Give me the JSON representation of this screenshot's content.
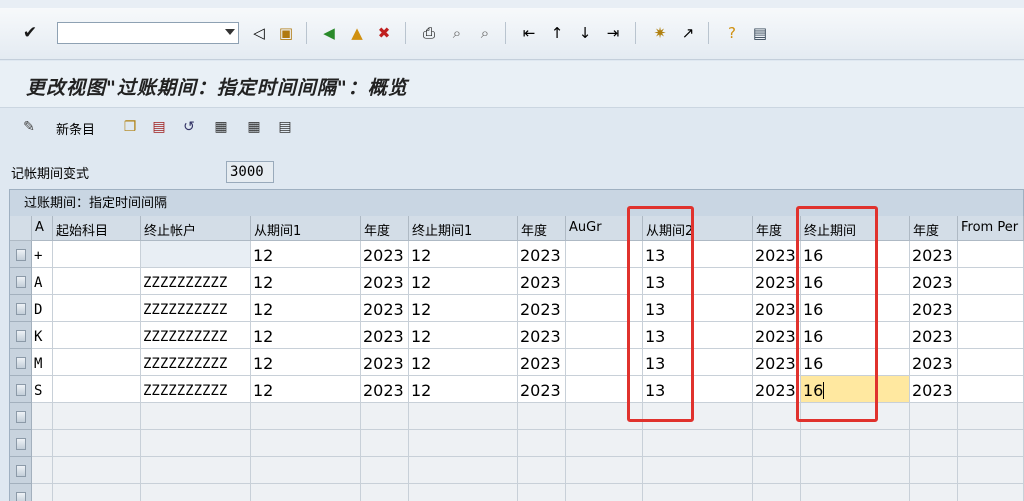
{
  "toolbar": {
    "command_value": "",
    "icons": [
      "enter-icon",
      "back-icon",
      "save-icon",
      "back-nav-icon",
      "exit-icon",
      "cancel-icon",
      "print-icon",
      "find-icon",
      "find-next-icon",
      "first-page-icon",
      "prev-page-icon",
      "next-page-icon",
      "last-page-icon",
      "new-session-icon",
      "shortcut-icon",
      "help-icon",
      "layout-icon"
    ]
  },
  "title": "更改视图\"过账期间：指定时间间隔\"：概览",
  "app_toolbar": {
    "new_entries": "新条目"
  },
  "variant": {
    "label": "记帐期间变式",
    "value": "3000"
  },
  "table": {
    "caption": "过账期间：指定时间间隔",
    "columns": [
      "A",
      "起始科目",
      "终止帐户",
      "从期间1",
      "年度",
      "终止期间1",
      "年度",
      "AuGr",
      "从期间2",
      "年度",
      "终止期间",
      "年度",
      "From Per"
    ],
    "rows": [
      [
        "+",
        "",
        "",
        "12",
        "2023",
        "12",
        "2023",
        "",
        "13",
        "2023",
        "16",
        "2023",
        ""
      ],
      [
        "A",
        "",
        "ZZZZZZZZZZ",
        "12",
        "2023",
        "12",
        "2023",
        "",
        "13",
        "2023",
        "16",
        "2023",
        ""
      ],
      [
        "D",
        "",
        "ZZZZZZZZZZ",
        "12",
        "2023",
        "12",
        "2023",
        "",
        "13",
        "2023",
        "16",
        "2023",
        ""
      ],
      [
        "K",
        "",
        "ZZZZZZZZZZ",
        "12",
        "2023",
        "12",
        "2023",
        "",
        "13",
        "2023",
        "16",
        "2023",
        ""
      ],
      [
        "M",
        "",
        "ZZZZZZZZZZ",
        "12",
        "2023",
        "12",
        "2023",
        "",
        "13",
        "2023",
        "16",
        "2023",
        ""
      ],
      [
        "S",
        "",
        "ZZZZZZZZZZ",
        "12",
        "2023",
        "12",
        "2023",
        "",
        "13",
        "2023",
        "16",
        "2023",
        ""
      ]
    ]
  },
  "colors": {
    "highlight_box": "#e0322d",
    "focus_cell": "#ffe8a0"
  }
}
